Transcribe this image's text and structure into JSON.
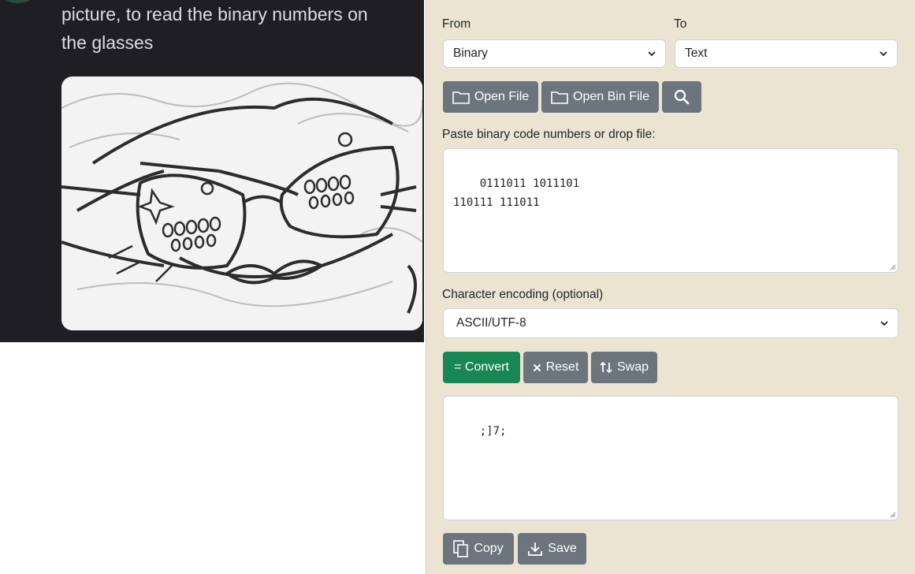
{
  "chat": {
    "message_lines": [
      "picture, to read the binary numbers on",
      "the glasses"
    ]
  },
  "converter": {
    "from_label": "From",
    "from_value": "Binary",
    "to_label": "To",
    "to_value": "Text",
    "open_file_label": "Open File",
    "open_bin_file_label": "Open Bin File",
    "search_icon": "search-icon",
    "input_label": "Paste binary code numbers or drop file:",
    "input_value": "0111011 1011101\n110111 111011",
    "encoding_label": "Character encoding (optional)",
    "encoding_value": "ASCII/UTF-8",
    "convert_label": "= Convert",
    "reset_label": "Reset",
    "swap_label": "Swap",
    "output_value": ";]7;",
    "copy_label": "Copy",
    "save_label": "Save"
  },
  "colors": {
    "panel_bg": "#ece4d3",
    "button_gray": "#6c757d",
    "button_green": "#198754",
    "chat_bg": "#1f1f23"
  }
}
